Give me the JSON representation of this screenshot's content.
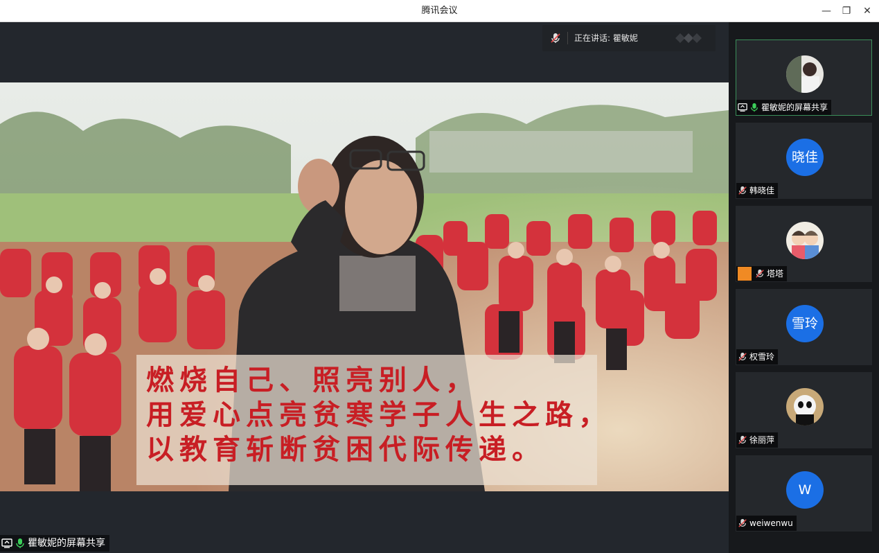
{
  "window": {
    "title": "腾讯会议",
    "min_icon": "minimize-icon",
    "max_icon": "restore-icon",
    "close_icon": "close-icon"
  },
  "speaking": {
    "label": "正在讲话: 瞿敏妮"
  },
  "shared_screen": {
    "caption_lines": [
      "燃烧自己、照亮别人，",
      "用爱心点亮贫寒学子人生之路，",
      "以教育斩断贫困代际传递。"
    ],
    "owner_label": "瞿敏妮的屏幕共享"
  },
  "participants": [
    {
      "name": "瞿敏妮的屏幕共享",
      "avatar_type": "photo",
      "initials": "",
      "active": true
    },
    {
      "name": "韩晓佳",
      "avatar_type": "initials",
      "initials": "晓佳"
    },
    {
      "name": "塔塔",
      "avatar_type": "cartoon",
      "initials": ""
    },
    {
      "name": "权雪玲",
      "avatar_type": "initials",
      "initials": "雪玲"
    },
    {
      "name": "徐丽萍",
      "avatar_type": "panda",
      "initials": ""
    },
    {
      "name": "weiwenwu",
      "avatar_type": "initials",
      "initials": "W"
    }
  ],
  "colors": {
    "accent_blue": "#1b6fe5",
    "active_border": "#3b8f5a",
    "caption_red": "#c81e24"
  }
}
